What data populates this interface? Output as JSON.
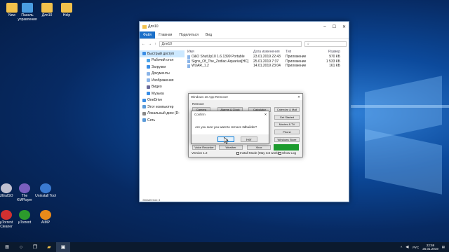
{
  "desktop": {
    "top_icons": [
      {
        "label": "New",
        "color": "#f2c14b"
      },
      {
        "label": "Панель управления",
        "color": "#4a9de0"
      },
      {
        "label": "Для10",
        "color": "#f2c14b"
      },
      {
        "label": "Help",
        "color": "#f2c14b"
      }
    ],
    "bottom_icons": [
      {
        "label": "UltraISO",
        "color": "#c0c0d0"
      },
      {
        "label": "The KMPlayer",
        "color": "#7a5fbf"
      },
      {
        "label": "Uninstall Tool",
        "color": "#3a7ad0"
      },
      {
        "label": "µTorrent Cleaner",
        "color": "#d03030"
      },
      {
        "label": "µTorrent",
        "color": "#2c9a2c"
      },
      {
        "label": "AIMP",
        "color": "#e88a1a"
      }
    ]
  },
  "explorer": {
    "title": "Для10",
    "ribbon_tabs": [
      "Файл",
      "Главная",
      "Поделиться",
      "Вид"
    ],
    "address": "Для10",
    "nav_items": [
      {
        "label": "Быстрый доступ",
        "sub": false,
        "selected": true,
        "color": "#3a8ee6"
      },
      {
        "label": "Рабочий стол",
        "sub": true,
        "selected": false,
        "color": "#4aa3e8"
      },
      {
        "label": "Загрузки",
        "sub": true,
        "selected": false,
        "color": "#3a8ee6"
      },
      {
        "label": "Документы",
        "sub": true,
        "selected": false,
        "color": "#8ab4e8"
      },
      {
        "label": "Изображения",
        "sub": true,
        "selected": false,
        "color": "#8ab4e8"
      },
      {
        "label": "Видео",
        "sub": true,
        "selected": false,
        "color": "#6a6a9a"
      },
      {
        "label": "Музыка",
        "sub": true,
        "selected": false,
        "color": "#3a8ee6"
      },
      {
        "label": "OneDrive",
        "sub": false,
        "selected": false,
        "color": "#3a8ee6"
      },
      {
        "label": "Этот компьютер",
        "sub": false,
        "selected": false,
        "color": "#5a9ad8"
      },
      {
        "label": "Локальный диск (D:",
        "sub": false,
        "selected": false,
        "color": "#888"
      },
      {
        "label": "Сеть",
        "sub": false,
        "selected": false,
        "color": "#5a9ad8"
      }
    ],
    "columns": [
      "Имя",
      "Дата изменения",
      "Тип",
      "Размер"
    ],
    "files": [
      {
        "name": "O&O ShutUp10 1.6.1399 Portable",
        "date": "23.01.2019 22:43",
        "type": "Приложение",
        "size": "970 КБ"
      },
      {
        "name": "Signs_Of_The_Zodiac-Aquarius[HC]",
        "date": "25.01.2019 7:37",
        "type": "Приложение",
        "size": "1 533 КБ"
      },
      {
        "name": "WXAR_1.2",
        "date": "14.01.2019 23:04",
        "type": "Приложение",
        "size": "161 КБ"
      }
    ],
    "status": "Элементов: 3"
  },
  "remover": {
    "title": "Windows 10 App Remover",
    "remove_label": "Remove",
    "version": "Version 1.2",
    "install_mode": "Install Mode (May not work)",
    "show_log": "Show Log",
    "buttons": [
      "Camera",
      "Alarms & Clock",
      "Calculator",
      "Calendar & Mail",
      "Get Started",
      "Movies & TV",
      "Phone",
      "Windows Store",
      "Voice Recorder",
      "Weather",
      "Xbox"
    ]
  },
  "confirm": {
    "title": "Confirm",
    "message": "Are you sure you want to remove 3dbuilder?",
    "yes": "Да",
    "no": "Нет"
  },
  "taskbar": {
    "lang": "РУС",
    "time": "22:59",
    "date": "25.01.2019"
  }
}
